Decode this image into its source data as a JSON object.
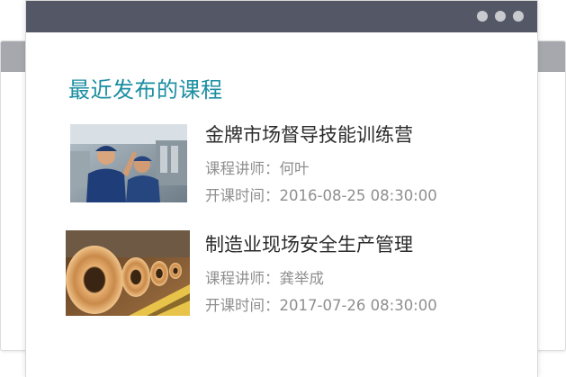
{
  "section": {
    "title": "最近发布的课程"
  },
  "labels": {
    "lecturer": "课程讲师：",
    "start_time": "开课时间："
  },
  "courses": [
    {
      "title": "金牌市场督导技能训练营",
      "lecturer": "何叶",
      "start_time": "2016-08-25 08:30:00",
      "image": "factory-workers-photo"
    },
    {
      "title": "制造业现场安全生产管理",
      "lecturer": "龚举成",
      "start_time": "2017-07-26 08:30:00",
      "image": "steel-coils-photo"
    }
  ],
  "colors": {
    "title_bar": "#545866",
    "accent": "#1b8ea2",
    "back_bar": "#a7a8ad"
  }
}
